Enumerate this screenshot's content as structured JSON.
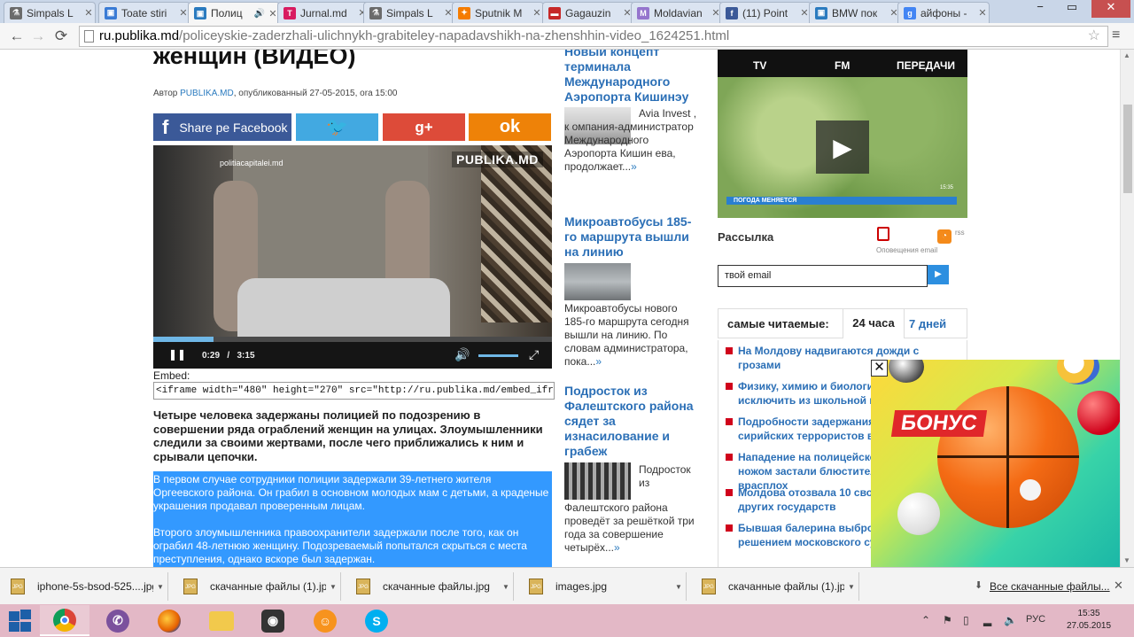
{
  "browser": {
    "tabs": [
      {
        "label": "Simpals L",
        "color": "#6b6b6b",
        "glyph": "⚗",
        "active": false
      },
      {
        "label": "Toate stiri",
        "color": "#3a7bd5",
        "glyph": "▣",
        "active": false
      },
      {
        "label": "Полиц",
        "color": "#2b7bbf",
        "glyph": "▣",
        "active": true
      },
      {
        "label": "Jurnal.md",
        "color": "#d81b60",
        "glyph": "T",
        "active": false
      },
      {
        "label": "Simpals L",
        "color": "#6b6b6b",
        "glyph": "⚗",
        "active": false
      },
      {
        "label": "Sputnik M",
        "color": "#f57c00",
        "glyph": "✦",
        "active": false
      },
      {
        "label": "Gagauzin",
        "color": "#c62828",
        "glyph": "▬",
        "active": false
      },
      {
        "label": "Moldavian",
        "color": "#9575cd",
        "glyph": "M",
        "active": false
      },
      {
        "label": "(11) Point",
        "color": "#3b5998",
        "glyph": "f",
        "active": false
      },
      {
        "label": "BMW пок",
        "color": "#2b7bbf",
        "glyph": "▣",
        "active": false
      },
      {
        "label": "айфоны -",
        "color": "#4285f4",
        "glyph": "g",
        "active": false
      }
    ],
    "audio_icon": "🔊",
    "url_host": "ru.publika.md",
    "url_path": "/policeyskie-zaderzhali-ulichnykh-grabiteley-napadavshikh-na-zhenshhin-video_1624251.html"
  },
  "article": {
    "title": "женщин (ВИДЕО)",
    "meta_prefix": "Автор ",
    "meta_author": "PUBLIKA.MD",
    "meta_suffix": ", опубликованный 27-05-2015, ora 15:00",
    "share_facebook_label": "Share pe Facebook",
    "share_twitter_glyph": "🐦",
    "share_gplus_glyph": "g+",
    "share_ok_glyph": "ok",
    "video": {
      "watermark": "politiacapitalei.md",
      "brand": "PUBLIKA.MD",
      "current_time": "0:29",
      "separator": "/",
      "duration": "3:15",
      "progress": 0.15,
      "volume": 0.9
    },
    "embed_label": "Embed:",
    "embed_code": "<iframe width=\"480\" height=\"270\" src=\"http://ru.publika.md/embed_iframe.php?id=",
    "lead": "Четыре человека задержаны полицией по подозрению в совершении ряда ограблений женщин на улицах. Злоумышленники следили за своими жертвами, после чего приближались к ним и срывали цепочки.",
    "paragraph1": "В первом случае сотрудники полиции задержали 39-летнего жителя Оргеевского района. Он грабил в основном молодых мам с детьми, а краденые украшения продавал проверенным лицам.",
    "paragraph2": "Второго злоумышленника правоохранители задержали после того, как он ограбил 48-летнюю женщину. Подозреваемый попытался скрыться с места преступления, однако вскоре был задержан."
  },
  "middle_column": {
    "item1_title": "Новый концепт терминала Международного Аэропорта Кишинэу",
    "item1_text": "Avia Invest , к омпания-администратор Международного Аэропорта Кишин ева, продолжает...",
    "item2_title": "Микроавтобусы 185-го маршрута вышли на линию",
    "item2_text": "Микроавтобусы нового 185-го маршрута сегодня вышли на линию. По словам администратора, пока...",
    "item3_title": "Подросток из Фалештского района сядет за изнасилование и грабеж",
    "item3_text_a": "Подросток из",
    "item3_text_b": "Фалештского района проведёт за решёткой три года за совершение четырёх...",
    "more_glyph": "»"
  },
  "right_column": {
    "radio_tabs": [
      "TV",
      "FM",
      "ПЕРЕДАЧИ"
    ],
    "ticker": "ПОГОДА МЕНЯЕТСЯ",
    "ticker_time": "15:35",
    "newsletter_label": "Рассылка",
    "notif_label": "Оповещения email",
    "rss_label": "rss",
    "email_value": "твой email",
    "popular_label": "самые читаемые:",
    "tab_24h": "24 часа",
    "tab_7d": "7 дней",
    "popular": [
      "На Молдову надвигаются дожди с грозами",
      "Физику, химию и биологию хотят исключить из школьной программы",
      "Подробности задержания в Молдове сирийских террористов в аэропорту",
      "Нападение на полицейского в Кишинёве: ножом застали блюстителя порядка врасплох",
      "Молдова отозвала 10 своих послов из других государств",
      "Бывшая балерина выброшена в окно решением московского суда"
    ]
  },
  "ad": {
    "label": "БОНУС",
    "close_glyph": "✕"
  },
  "downloads": {
    "items": [
      "iphone-5s-bsod-525....jpg",
      "скачанные файлы (1).jpg",
      "скачанные файлы.jpg",
      "images.jpg",
      "скачанные файлы (1).jpg"
    ],
    "show_all": "Все скачанные файлы...",
    "close_glyph": "✕"
  },
  "taskbar": {
    "lang": "РУС",
    "time": "15:35",
    "date": "27.05.2015"
  }
}
